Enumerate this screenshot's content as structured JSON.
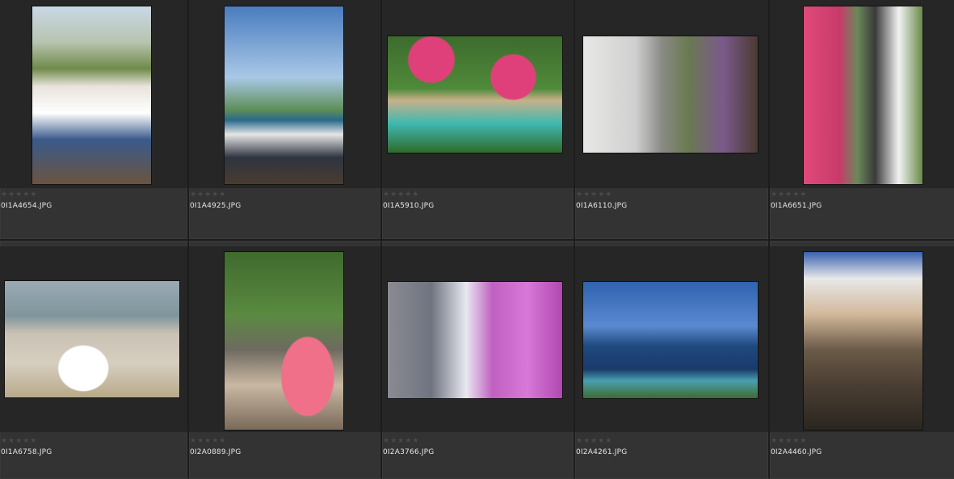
{
  "photos": [
    {
      "filename": "0I1A4654.JPG",
      "rating": "★★★★★",
      "subject": "couple-street-photo"
    },
    {
      "filename": "0I1A4925.JPG",
      "rating": "★★★★★",
      "subject": "couple-poolside-photo"
    },
    {
      "filename": "0I1A5910.JPG",
      "rating": "★★★★★",
      "subject": "couple-pink-umbrellas-photo"
    },
    {
      "filename": "0I1A6110.JPG",
      "rating": "★★★★★",
      "subject": "couple-railing-photo"
    },
    {
      "filename": "0I1A6651.JPG",
      "rating": "★★★★★",
      "subject": "couple-flowers-photo"
    },
    {
      "filename": "0I1A6758.JPG",
      "rating": "★★★★★",
      "subject": "couple-beach-photo"
    },
    {
      "filename": "0I2A0889.JPG",
      "rating": "★★★★★",
      "subject": "couple-pink-gown-photo"
    },
    {
      "filename": "0I2A3766.JPG",
      "rating": "★★★★★",
      "subject": "couple-veil-photo"
    },
    {
      "filename": "0I2A4261.JPG",
      "rating": "★★★★★",
      "subject": "ocean-walkway-photo"
    },
    {
      "filename": "0I2A4460.JPG",
      "rating": "★★★★★",
      "subject": "couple-rocks-photo"
    }
  ],
  "colors": {
    "background": "#2a2a2a",
    "cell": "#333333",
    "frame": "#262626",
    "filename_text": "#e6e6e6",
    "star_inactive": "#4a4a4a"
  }
}
